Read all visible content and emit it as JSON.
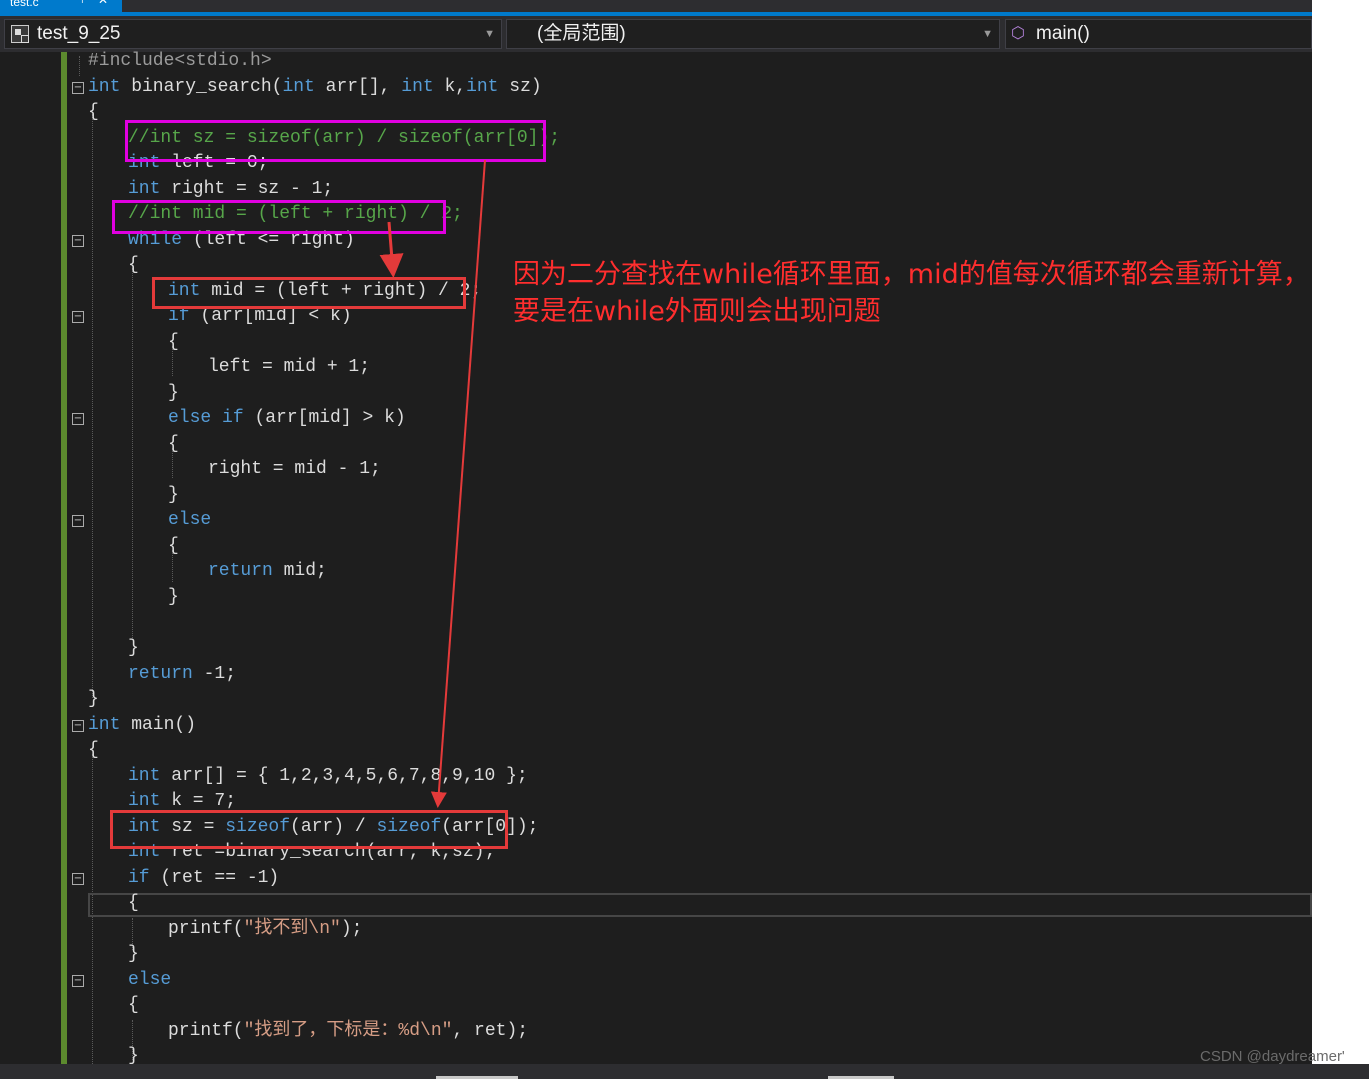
{
  "tab": {
    "label": "test.c",
    "pin": "⊣",
    "close": "✕"
  },
  "nav": {
    "project": "test_9_25",
    "scope": "(全局范围)",
    "member": "main()"
  },
  "code": {
    "l1": [
      "#include<stdio.h>"
    ],
    "l2": [
      "int",
      " binary_search(",
      "int",
      " arr[], ",
      "int",
      " k,",
      "int",
      " sz)"
    ],
    "l3": [
      "{"
    ],
    "l4": [
      "//int sz = sizeof(arr) / sizeof(arr[0]);"
    ],
    "l5": [
      "int",
      " left = 0;"
    ],
    "l6": [
      "int",
      " right = sz - 1;"
    ],
    "l7": [
      "//int mid = (left + right) / 2;"
    ],
    "l8": [
      "while",
      " (left <= right)"
    ],
    "l9": [
      "{"
    ],
    "l10": [
      "int",
      " mid = (left + right) / 2;"
    ],
    "l11": [
      "if",
      " (arr[mid] < k)"
    ],
    "l12": [
      "{"
    ],
    "l13": [
      "left = mid + 1;"
    ],
    "l14": [
      "}"
    ],
    "l15": [
      "else",
      " ",
      "if",
      " (arr[mid] > k)"
    ],
    "l16": [
      "{"
    ],
    "l17": [
      "right = mid - 1;"
    ],
    "l18": [
      "}"
    ],
    "l19": [
      "else"
    ],
    "l20": [
      "{"
    ],
    "l21": [
      "return",
      " mid;"
    ],
    "l22": [
      "}"
    ],
    "l23": [
      "}"
    ],
    "l24": [
      "return",
      " -1;"
    ],
    "l25": [
      "}"
    ],
    "l26": [
      "int",
      " main()"
    ],
    "l27": [
      "{"
    ],
    "l28": [
      "int",
      " arr[] = { 1,2,3,4,5,6,7,8,9,10 };"
    ],
    "l29": [
      "int",
      " k = 7;"
    ],
    "l30": [
      "int",
      " sz = ",
      "sizeof",
      "(arr) / ",
      "sizeof",
      "(arr[0]);"
    ],
    "l31": [
      "int",
      " ret =binary_search(arr, k,sz);"
    ],
    "l32": [
      "if",
      " (ret == -1)"
    ],
    "l33": [
      "{"
    ],
    "l34": [
      "printf(",
      "\"找不到\\n\"",
      ");"
    ],
    "l35": [
      "}"
    ],
    "l36": [
      "else"
    ],
    "l37": [
      "{"
    ],
    "l38": [
      "printf(",
      "\"找到了，下标是：%d\\n\"",
      ", ret);"
    ],
    "l39": [
      "}"
    ]
  },
  "annotation": {
    "line1": "因为二分查找在while循环里面，mid的值每次循环都会重新计算，",
    "line2": "要是在while外面则会出现问题"
  },
  "colors": {
    "highlight_magenta": "#e000e0",
    "highlight_red": "#e43a3a",
    "annotation_text": "#ff2e2e",
    "accent": "#007acc"
  },
  "watermark": "CSDN @daydreamer'"
}
